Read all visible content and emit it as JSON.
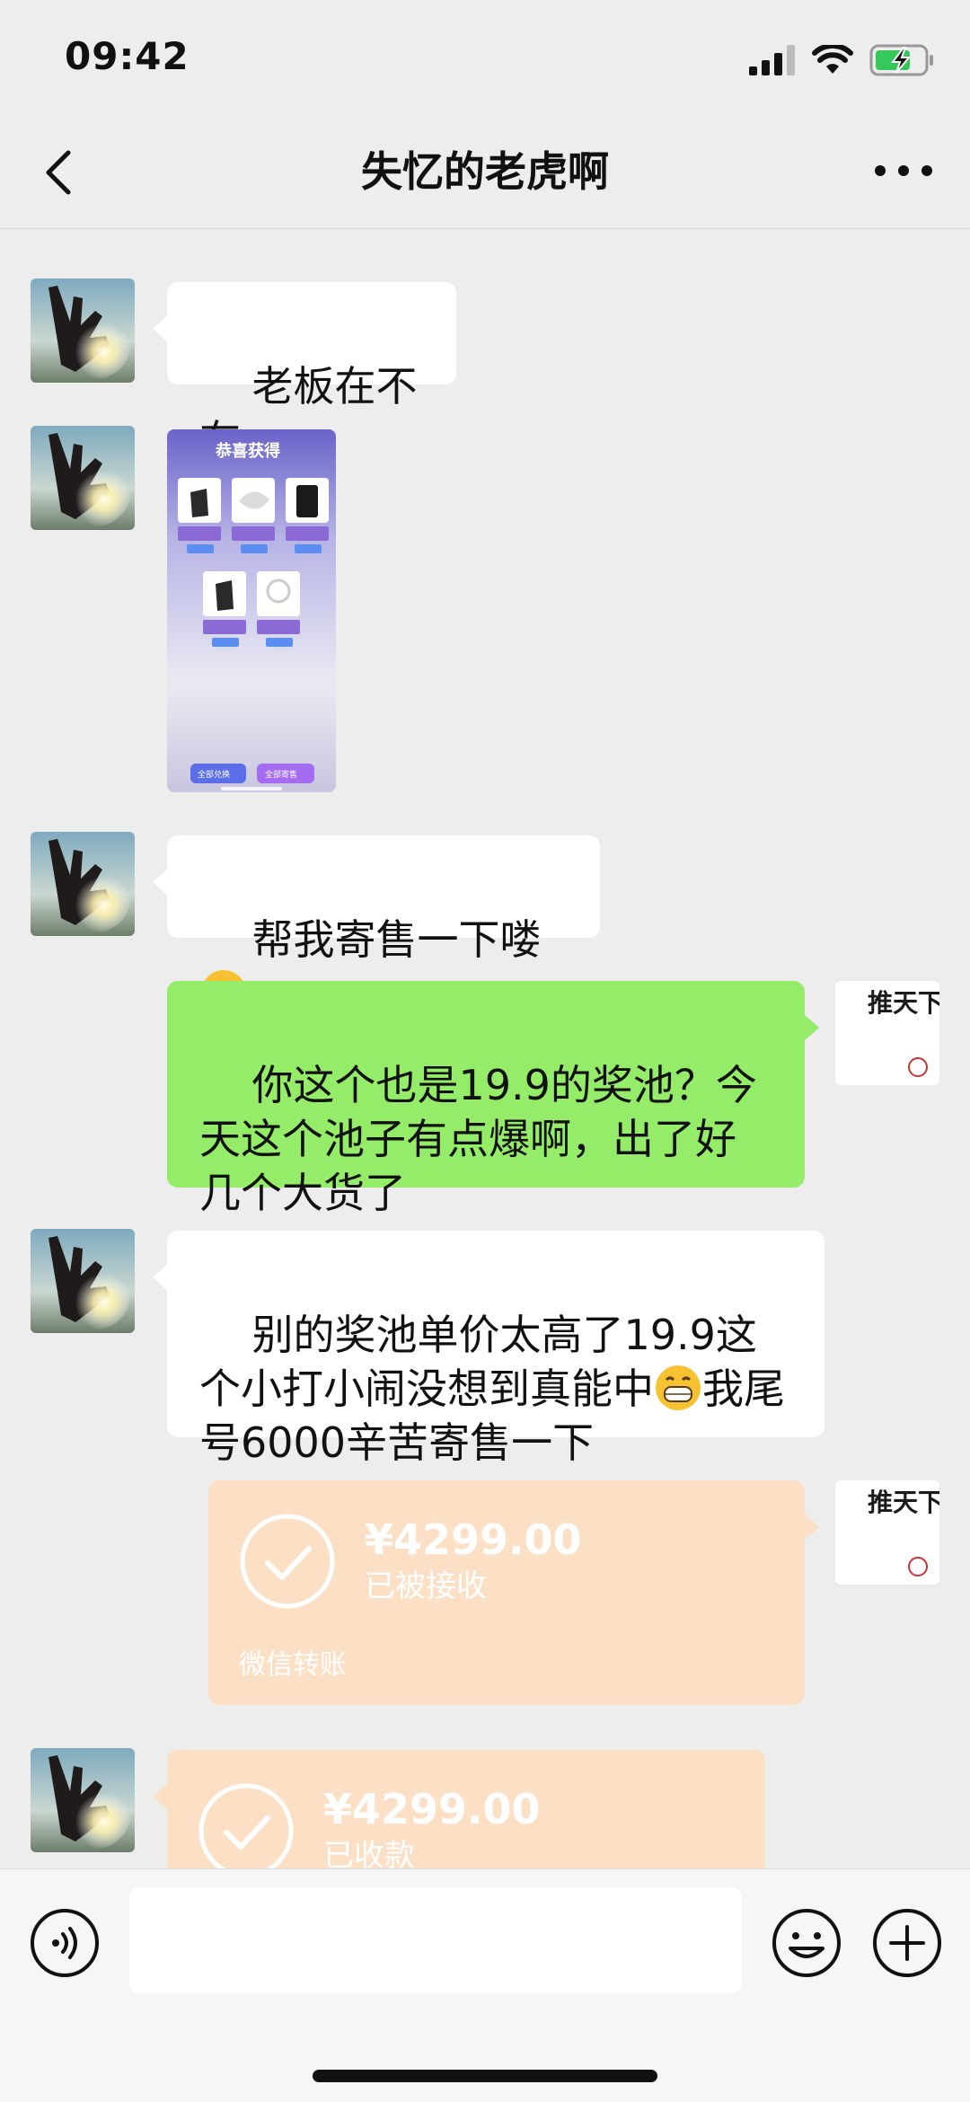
{
  "status_bar": {
    "time": "09:42",
    "icons": [
      "signal-icon",
      "wifi-icon",
      "battery-charging-icon"
    ]
  },
  "nav": {
    "title": "失忆的老虎啊",
    "back_icon": "chevron-left-icon",
    "more_icon": "more-dots-icon"
  },
  "messages": [
    {
      "side": "left",
      "type": "text",
      "text": "老板在不在"
    },
    {
      "side": "left",
      "type": "image",
      "image_title": "恭喜获得",
      "buttons": [
        "全部兑换",
        "全部寄售"
      ]
    },
    {
      "side": "left",
      "type": "text",
      "text": "帮我寄售一下喽",
      "emoji": "sunglasses-emoji"
    },
    {
      "side": "right",
      "type": "text",
      "text": "你这个也是19.9的奖池？今天这个池子有点爆啊，出了好几个大货了"
    },
    {
      "side": "left",
      "type": "text",
      "text_before": "别的奖池单价太高了19.9这个小打小闹没想到真能中",
      "emoji": "grin-emoji",
      "text_after": "我尾号6000辛苦寄售一下"
    },
    {
      "side": "right",
      "type": "transfer",
      "amount": "¥4299.00",
      "status": "已被接收",
      "footer": "微信转账"
    },
    {
      "side": "left",
      "type": "transfer",
      "amount": "¥4299.00",
      "status": "已收款"
    }
  ],
  "avatar_right": {
    "text": "推天下"
  },
  "input": {
    "placeholder": ""
  },
  "colors": {
    "background": "#ededed",
    "green_bubble": "#95ec69",
    "transfer_bg": "#fbe0c6",
    "input_bar": "#f6f6f6"
  }
}
